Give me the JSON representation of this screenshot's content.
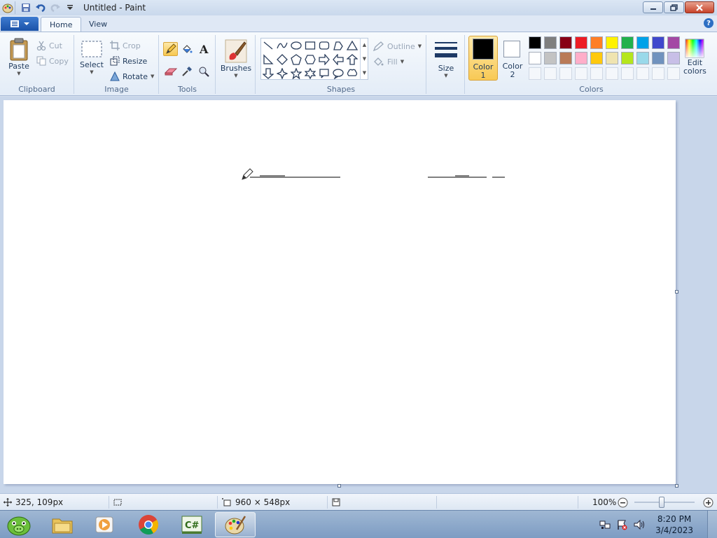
{
  "window": {
    "title": "Untitled - Paint"
  },
  "tabs": [
    {
      "label": "Home",
      "active": true
    },
    {
      "label": "View",
      "active": false
    }
  ],
  "ribbon": {
    "clipboard": {
      "label": "Clipboard",
      "paste": "Paste",
      "cut": "Cut",
      "copy": "Copy"
    },
    "image": {
      "label": "Image",
      "select": "Select",
      "crop": "Crop",
      "resize": "Resize",
      "rotate": "Rotate"
    },
    "tools": {
      "label": "Tools"
    },
    "brushes": {
      "label": "Brushes"
    },
    "shapes": {
      "label": "Shapes",
      "outline": "Outline",
      "fill": "Fill"
    },
    "size": {
      "label": "Size"
    },
    "colors": {
      "label": "Colors",
      "color1_line1": "Color",
      "color1_line2": "1",
      "color2_line1": "Color",
      "color2_line2": "2",
      "edit_line1": "Edit",
      "edit_line2": "colors",
      "color1_value": "#000000",
      "color2_value": "#ffffff",
      "palette_row1": [
        "#000000",
        "#7f7f7f",
        "#880015",
        "#ed1c24",
        "#ff7f27",
        "#fff200",
        "#22b14c",
        "#00a2e8",
        "#3f48cc",
        "#a349a4"
      ],
      "palette_row2": [
        "#ffffff",
        "#c3c3c3",
        "#b97a57",
        "#ffaec9",
        "#ffc90e",
        "#efe4b0",
        "#b5e61d",
        "#99d9ea",
        "#7092be",
        "#c8bfe7"
      ]
    }
  },
  "statusbar": {
    "cursor_pos": "325, 109px",
    "canvas_size": "960 × 548px",
    "zoom": "100%",
    "zoom_fraction": 0.45
  },
  "taskbar": {
    "time": "8:20 PM",
    "date": "3/4/2023"
  }
}
